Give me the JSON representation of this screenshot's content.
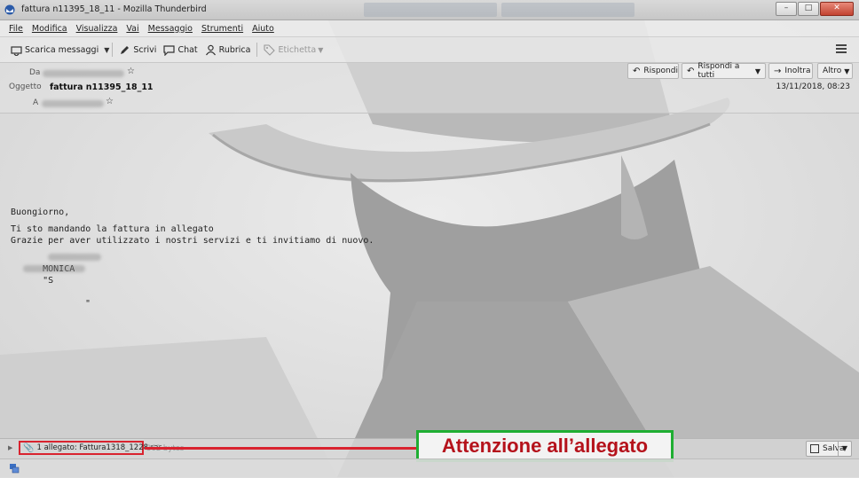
{
  "window": {
    "title": "fattura n11395_18_11 - Mozilla Thunderbird",
    "controls": {
      "minimize": "–",
      "maximize": "□",
      "close": "✕"
    }
  },
  "menu": [
    "File",
    "Modifica",
    "Visualizza",
    "Vai",
    "Messaggio",
    "Strumenti",
    "Aiuto"
  ],
  "toolbar": {
    "get_messages": "Scarica messaggi",
    "write": "Scrivi",
    "chat": "Chat",
    "address_book": "Rubrica",
    "tag": "Etichetta"
  },
  "header": {
    "from_label": "Da",
    "subject_label": "Oggetto",
    "subject": "fattura n11395_18_11",
    "to_label": "A",
    "date": "13/11/2018, 08:23",
    "buttons": {
      "reply": "Rispondi",
      "reply_all": "Rispondi a tutti",
      "forward": "Inoltra",
      "more": "Altro"
    }
  },
  "body": {
    "greeting": "Buongiorno,",
    "line1": "Ti sto mandando la fattura in allegato",
    "line2": "Grazie per aver utilizzato i nostri servizi e ti invitiamo di nuovo.",
    "signature_name": "MONICA",
    "signature_company_open": "\"S",
    "signature_company_close": "\""
  },
  "attachment": {
    "label": "1 allegato: Fattura1318_1228.rar",
    "size": "362 bytes",
    "save": "Salva"
  },
  "annotation": {
    "callout": "Attenzione all’allegato",
    "colors": {
      "highlight": "#d9232f",
      "callout_border": "#1fae32",
      "callout_text": "#b5121b"
    }
  }
}
